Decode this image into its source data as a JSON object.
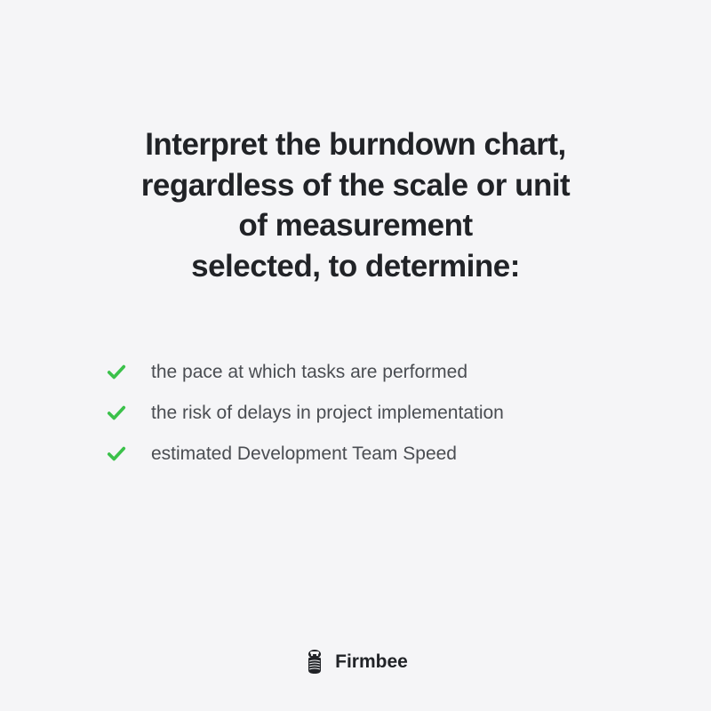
{
  "heading": {
    "line1": "Interpret the burndown chart,",
    "line2": "regardless of the scale or unit",
    "line3": "of measurement",
    "line4": "selected, to determine:"
  },
  "items": [
    "the pace at which tasks are performed",
    "the risk of delays in project implementation",
    "estimated Development Team Speed"
  ],
  "brand": "Firmbee",
  "colors": {
    "check": "#3bc14a",
    "text": "#212327"
  }
}
